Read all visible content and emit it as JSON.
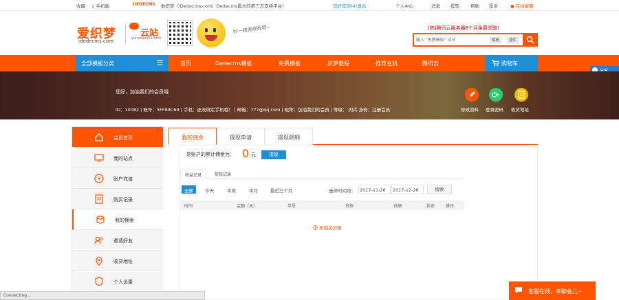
{
  "topbar": {
    "items": [
      "收藏",
      "手机版",
      "数织梦（iDedecms.com）Dedecms最大的第三方支持平台！",
      "您好欢迎(4)退出",
      "个人中心",
      "消息",
      "提现",
      "帮助",
      "投诉",
      "在线客服"
    ]
  },
  "header": {
    "logo": "爱织梦",
    "logo_sub": "idedecms.com",
    "yun": "云站",
    "yun_sub": "yunzhan123.com",
    "slogan": "好一精美模板哦~",
    "promo": "[热]腾讯云服务器8个月免费领取!",
    "search_placeholder": "输入 \"免费模板\" 试试",
    "search_tabs": [
      "模板",
      "插件"
    ]
  },
  "nav": {
    "category": "全部模板分类",
    "items": [
      "首页",
      "Dedecms模板",
      "免费模板",
      "织梦教程",
      "推荐主机",
      "腾讯云"
    ],
    "cart": "购物车"
  },
  "float": {
    "share": "分享"
  },
  "banner": {
    "greeting": "您好，加油我们的会员哦",
    "info": "ID：10082  |  账号：5FF89C69  |  手机：还没绑定手机哦！  |  邮箱：777@qq.com  |  昵称：加油我们的会员  |  等级：  列兵  身份：注册会员",
    "actions": [
      "修改资料",
      "登录密码",
      "收货地址"
    ]
  },
  "sidebar": {
    "items": [
      "会员首页",
      "我的站点",
      "账户充值",
      "购买记录",
      "我的佣金",
      "邀请好友",
      "收货地址",
      "个人设置"
    ]
  },
  "tabs": [
    "我的佣金",
    "提现申请",
    "提现明细"
  ],
  "commission": {
    "label": "您账户的累计佣金为：",
    "value": "0",
    "unit": "元",
    "withdraw": "提现"
  },
  "subtabs": [
    "收益记录",
    "提现记录"
  ],
  "filters": {
    "ranges": [
      "全部",
      "今天",
      "本周",
      "本月",
      "最近三个月"
    ],
    "date_label": "选择时间段：",
    "date_from": "2017-11-28",
    "date_to": "2017-12-28",
    "search": "搜索"
  },
  "table": {
    "headers": [
      "时间",
      "金额（元）",
      "单号",
      "名称",
      "详细",
      "状态",
      "操作"
    ],
    "empty": "无相关记录"
  },
  "chat": "客服在线，来聊会儿~",
  "status": "Connecting..."
}
